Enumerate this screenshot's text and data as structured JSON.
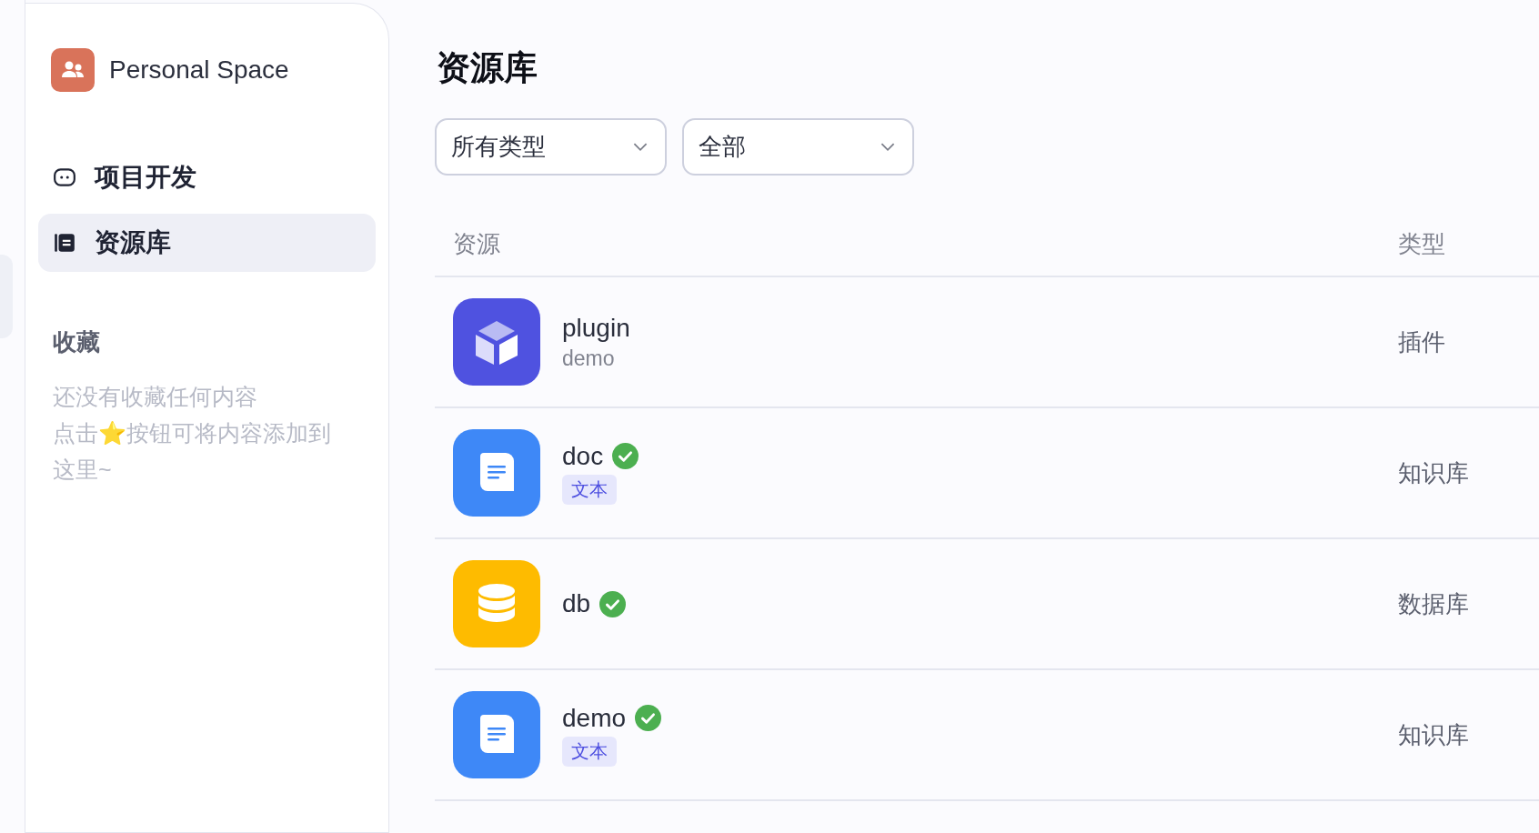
{
  "sidebar": {
    "workspace": "Personal Space",
    "nav": [
      {
        "label": "项目开发",
        "selected": false
      },
      {
        "label": "资源库",
        "selected": true
      }
    ],
    "favorites": {
      "title": "收藏",
      "empty_text": [
        "还没有收藏任何内容",
        "点击⭐按钮可将内容添加到这里~"
      ]
    }
  },
  "main": {
    "title": "资源库",
    "filters": [
      {
        "value": "所有类型"
      },
      {
        "value": "全部"
      }
    ],
    "table": {
      "columns": [
        "资源",
        "类型"
      ],
      "rows": [
        {
          "kind": "plugin",
          "name": "plugin",
          "subtitle": "demo",
          "verified": false,
          "type": "插件"
        },
        {
          "kind": "doc",
          "name": "doc",
          "tag": "文本",
          "verified": true,
          "type": "知识库"
        },
        {
          "kind": "db",
          "name": "db",
          "verified": true,
          "type": "数据库"
        },
        {
          "kind": "doc",
          "name": "demo",
          "tag": "文本",
          "verified": true,
          "type": "知识库"
        }
      ]
    }
  }
}
